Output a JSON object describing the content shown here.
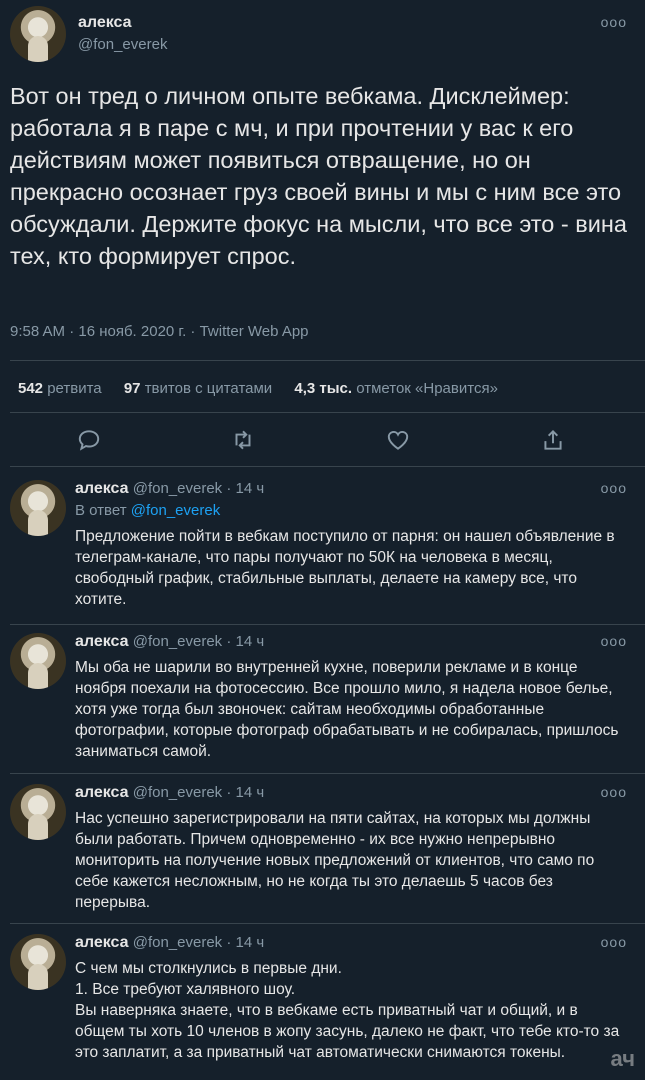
{
  "main_tweet": {
    "name": "алекса",
    "handle": "@fon_everek",
    "text": "Вот он тред о личном опыте вебкама. Дисклеймер: работала я в паре с мч, и при прочтении у вас к его действиям может появиться отвращение, но он прекрасно осознает груз своей вины и мы с ним все это обсуждали. Держите фокус на мысли, что все это - вина тех, кто формирует спрос.",
    "meta": "9:58 AM · 16 нояб. 2020 г. · Twitter Web App",
    "stats": {
      "retweets_count": "542",
      "retweets_label": "ретвита",
      "quotes_count": "97",
      "quotes_label": "твитов с цитатами",
      "likes_count": "4,3 тыс.",
      "likes_label": "отметок «Нравится»"
    },
    "more": "ooo"
  },
  "replies": [
    {
      "name": "алекса",
      "handle": "@fon_everek",
      "time": "· 14 ч",
      "reply_to_label": "В ответ",
      "reply_to_handle": "@fon_everek",
      "text": "Предложение пойти в вебкам поступило от парня: он нашел объявление в телеграм-канале, что пары получают по 50К на человека в месяц, свободный график, стабильные выплаты, делаете на камеру все, что хотите."
    },
    {
      "name": "алекса",
      "handle": "@fon_everek",
      "time": "· 14 ч",
      "text": "Мы оба не шарили во внутренней кухне, поверили рекламе и в конце ноября поехали на фотосессию. Все прошло мило, я надела новое белье, хотя уже тогда был звоночек: сайтам необходимы обработанные фотографии, которые фотограф обрабатывать и не собиралась, пришлось заниматься самой."
    },
    {
      "name": "алекса",
      "handle": "@fon_everek",
      "time": "· 14 ч",
      "text": "Нас успешно зарегистрировали на пяти сайтах, на которых мы должны были работать. Причем одновременно - их все нужно непрерывно мониторить на получение новых предложений от клиентов, что само по себе кажется несложным, но не когда ты это делаешь 5 часов без перерыва."
    },
    {
      "name": "алекса",
      "handle": "@fon_everek",
      "time": "· 14 ч",
      "text": "С чем мы столкнулись в первые дни.\n1. Все требуют халявного шоу.\nВы наверняка знаете, что в вебкаме есть приватный чат и общий, и в общем ты хоть 10 членов в жопу засунь, далеко не факт, что тебе кто-то за это заплатит, а за приватный чат автоматически снимаются токены."
    }
  ],
  "watermark": "ач"
}
